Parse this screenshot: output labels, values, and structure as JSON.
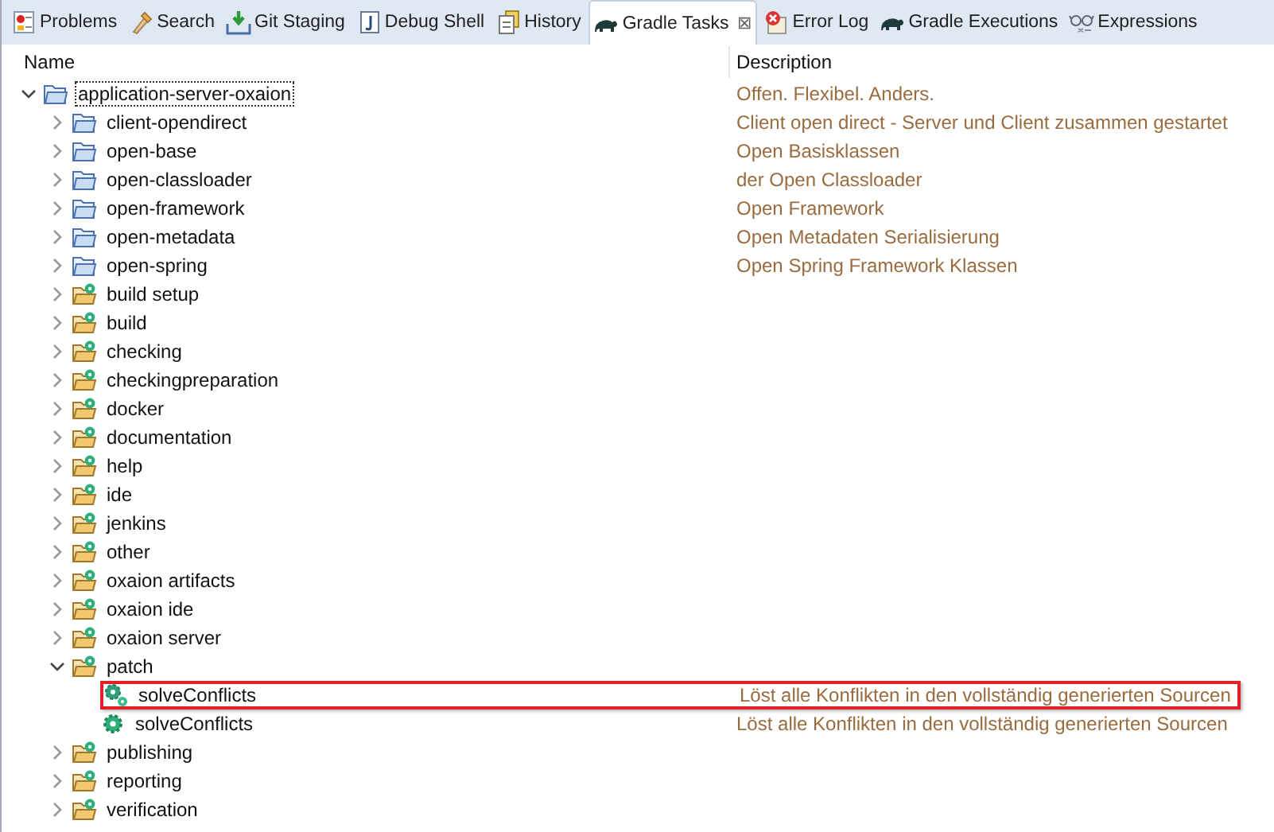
{
  "tabs": [
    {
      "label": "Problems",
      "kind": "problems",
      "selected": false
    },
    {
      "label": "Search",
      "kind": "search",
      "selected": false
    },
    {
      "label": "Git Staging",
      "kind": "staging",
      "selected": false
    },
    {
      "label": "Debug Shell",
      "kind": "shell",
      "selected": false
    },
    {
      "label": "History",
      "kind": "history",
      "selected": false
    },
    {
      "label": "Gradle Tasks",
      "kind": "gradle",
      "selected": true,
      "close": "⊠"
    },
    {
      "label": "Error Log",
      "kind": "errorlog",
      "selected": false
    },
    {
      "label": "Gradle Executions",
      "kind": "gradle",
      "selected": false
    },
    {
      "label": "Expressions",
      "kind": "expressions",
      "selected": false
    }
  ],
  "table": {
    "columns": [
      "Name",
      "Description"
    ],
    "rows": [
      {
        "kind": "project",
        "name": "application-server-oxaion",
        "description": "Offen. Flexibel. Anders.",
        "expanded": true,
        "focused": true,
        "children": [
          {
            "kind": "project",
            "name": "client-opendirect",
            "description": "Client open direct - Server und Client zusammen gestartet",
            "expanded": false
          },
          {
            "kind": "project",
            "name": "open-base",
            "description": "Open Basisklassen",
            "expanded": false
          },
          {
            "kind": "project",
            "name": "open-classloader",
            "description": "der Open Classloader",
            "expanded": false
          },
          {
            "kind": "project",
            "name": "open-framework",
            "description": "Open Framework",
            "expanded": false
          },
          {
            "kind": "project",
            "name": "open-metadata",
            "description": "Open Metadaten Serialisierung",
            "expanded": false
          },
          {
            "kind": "project",
            "name": "open-spring",
            "description": "Open Spring Framework Klassen",
            "expanded": false
          },
          {
            "kind": "group",
            "name": "build setup",
            "expanded": false
          },
          {
            "kind": "group",
            "name": "build",
            "expanded": false
          },
          {
            "kind": "group",
            "name": "checking",
            "expanded": false
          },
          {
            "kind": "group",
            "name": "checkingpreparation",
            "expanded": false
          },
          {
            "kind": "group",
            "name": "docker",
            "expanded": false
          },
          {
            "kind": "group",
            "name": "documentation",
            "expanded": false
          },
          {
            "kind": "group",
            "name": "help",
            "expanded": false
          },
          {
            "kind": "group",
            "name": "ide",
            "expanded": false
          },
          {
            "kind": "group",
            "name": "jenkins",
            "expanded": false
          },
          {
            "kind": "group",
            "name": "other",
            "expanded": false
          },
          {
            "kind": "group",
            "name": "oxaion artifacts",
            "expanded": false
          },
          {
            "kind": "group",
            "name": "oxaion ide",
            "expanded": false
          },
          {
            "kind": "group",
            "name": "oxaion server",
            "expanded": false
          },
          {
            "kind": "group",
            "name": "patch",
            "expanded": true,
            "children": [
              {
                "kind": "aggregate-task",
                "name": "solveConflicts",
                "description": "Löst alle Konflikten in den vollständig generierten Sourcen",
                "highlighted": true
              },
              {
                "kind": "task",
                "name": "solveConflicts",
                "description": "Löst alle Konflikten in den vollständig generierten Sourcen",
                "highlighted": false
              }
            ]
          },
          {
            "kind": "group",
            "name": "publishing",
            "expanded": false
          },
          {
            "kind": "group",
            "name": "reporting",
            "expanded": false
          },
          {
            "kind": "group",
            "name": "verification",
            "expanded": false
          }
        ]
      }
    ]
  }
}
